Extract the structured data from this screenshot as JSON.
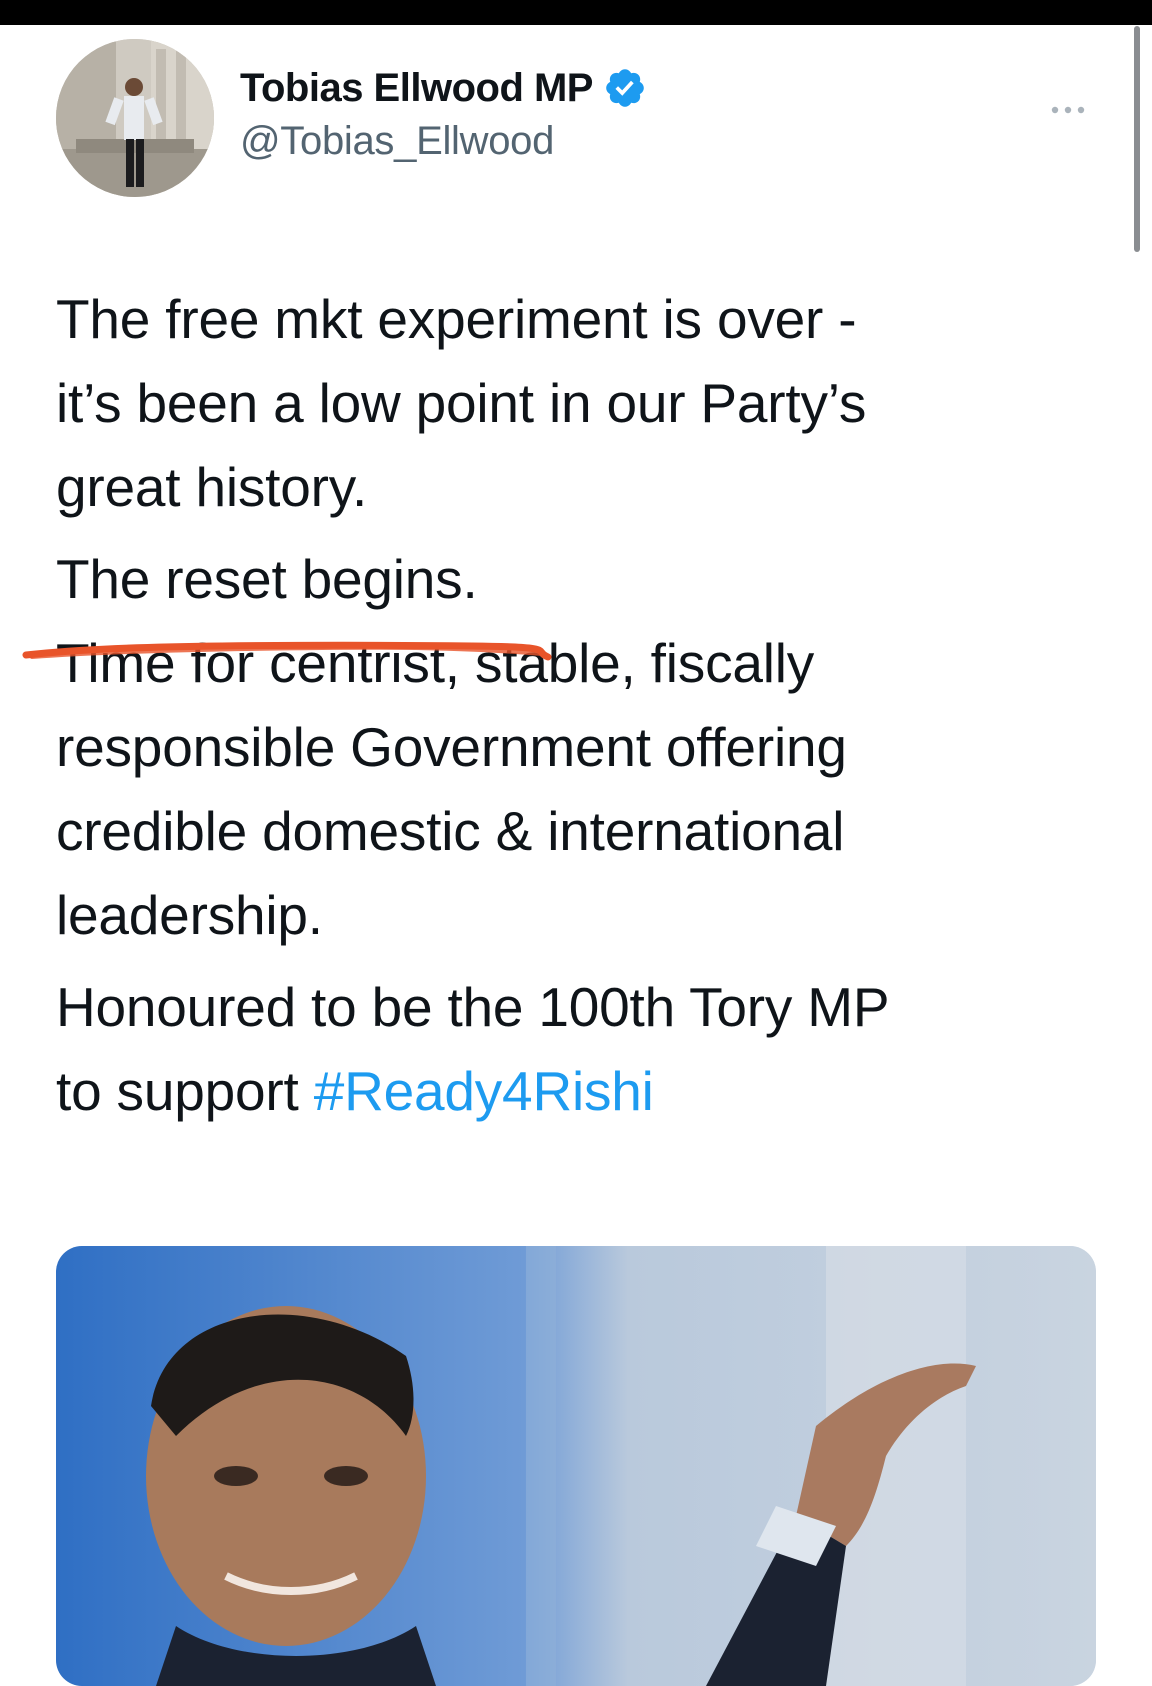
{
  "tweet": {
    "display_name": "Tobias Ellwood MP",
    "handle": "@Tobias_Ellwood",
    "verified_icon": "verified-badge-icon",
    "more_icon": "more-options-icon",
    "paragraphs": {
      "p1_line1": "The free mkt experiment is over -",
      "p1_line2": "it’s been a low point in our Party’s",
      "p1_line3": "great history.",
      "p2": "The reset begins.",
      "p3_line1": "Time for centrist, stable, fiscally",
      "p3_line2": "responsible Government offering",
      "p3_line3": "credible domestic & international",
      "p3_line4": "leadership.",
      "p4_line1": "Honoured to be the 100th Tory MP",
      "p4_line2_prefix": "to support ",
      "hashtag": "#Ready4Rishi"
    },
    "colors": {
      "hashtag": "#1d9bf0",
      "verified": "#1d9bf0",
      "underline_annotation": "#e8542a"
    }
  }
}
